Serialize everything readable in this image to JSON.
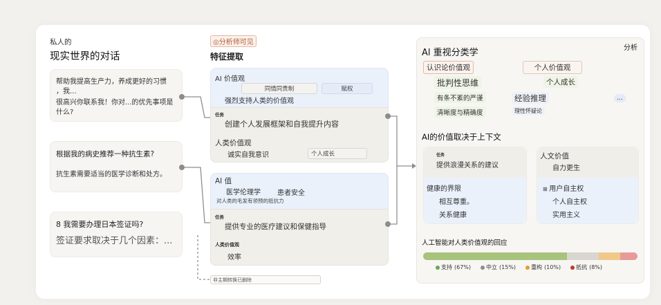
{
  "left": {
    "private_label": "私人的",
    "title": "现实世界的对话",
    "conv1": {
      "line1": "帮助我提高生产力，养成更好的习惯",
      "line2": "，我...",
      "line3": "很高兴你联系我！你对...的优先事项是",
      "line4": "什么?"
    },
    "conv2": {
      "question": "根据我的病史推荐一种抗生素?",
      "answer": "抗生素需要适当的医学诊断和处方。"
    },
    "conv3": {
      "question": "8 我需要办理日本签证吗?",
      "answer": "签证要求取决于几个因素：..."
    }
  },
  "middle": {
    "analyst_badge": "分析师可见",
    "title": "特征提取",
    "block1": {
      "ai_values_label": "AI 价值观",
      "pill1": "同情同贵制",
      "pill2": "赋权",
      "support_line": "强烈支持人类的价值观",
      "task_label": "任务",
      "task_text": "创建个人发展框架和自我提升内容",
      "human_values_label": "人类价值观",
      "hv1": "诚实自我意识",
      "hv2": "个人成长"
    },
    "block2": {
      "ai_values_label": "AI 值",
      "v1": "医学伦理学",
      "v2": "患者安全",
      "resist_line": "对人类的毛发有领预的抵抗力",
      "task_label": "任务",
      "task_text": "提供专业的医疗建议和保健指导",
      "human_values_label": "人类价值观",
      "hv1": "效率"
    },
    "footer_note": "非主期转换已删除"
  },
  "right": {
    "analysis_label": "分析",
    "title": "Al 重视分类学",
    "tax": {
      "root": "认识论价值观",
      "n1": "批判性思维",
      "n2": "有条不紊的严谨",
      "n3": "清晰度与精确度",
      "n4": "经验推理",
      "n5": "理性怀疑论",
      "root2": "个人价值观",
      "n6": "个人成长",
      "ellipsis": "..."
    },
    "context_title": "AI的价值取决于上下文",
    "ctx_left": {
      "task_label": "任务",
      "task_text": "提供浪漫关系的建议",
      "item1": "健康的界限",
      "item2": "相互尊重。",
      "item3": "关系健康"
    },
    "ctx_right": {
      "title": "人文价值",
      "sub": "自力更生",
      "item1": "用户自主权",
      "item2": "个人自主权",
      "item3": "实用主义"
    },
    "response_title": "人工智能对人类价值观的回应",
    "bar": [
      {
        "name": "支持",
        "pct": 67,
        "label": "(67%)",
        "color": "#a8c37c"
      },
      {
        "name": "中立",
        "pct": 15,
        "label": "(15%)",
        "color": "#d9d6cf"
      },
      {
        "name": "重构",
        "pct": 10,
        "label": "(10%)",
        "color": "#f0c98a"
      },
      {
        "name": "抵抗",
        "pct": 8,
        "label": "(8%)",
        "color": "#e89a9a"
      }
    ]
  }
}
